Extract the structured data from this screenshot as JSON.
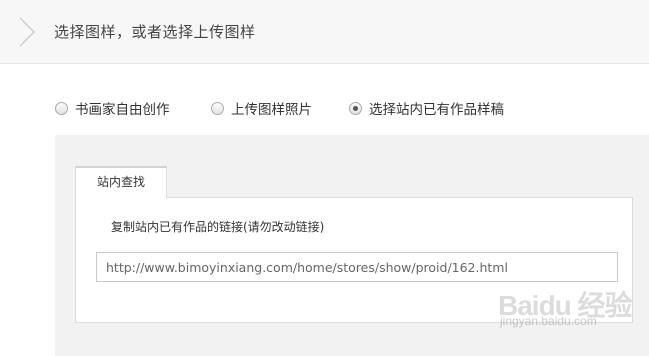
{
  "header": {
    "title": "选择图样，或者选择上传图样",
    "chevron_icon": "chevron-right-icon"
  },
  "options": [
    {
      "label": "书画家自由创作",
      "checked": false
    },
    {
      "label": "上传图样照片",
      "checked": false
    },
    {
      "label": "选择站内已有作品样稿",
      "checked": true
    }
  ],
  "search": {
    "tab_label": "站内查找",
    "instruction": "复制站内已有作品的链接(请勿改动链接)",
    "url_value": "http://www.bimoyinxiang.com/home/stores/show/proid/162.html"
  },
  "watermark": {
    "brand": "Baidu 经验",
    "sub": "jingyan.baidu.com"
  }
}
